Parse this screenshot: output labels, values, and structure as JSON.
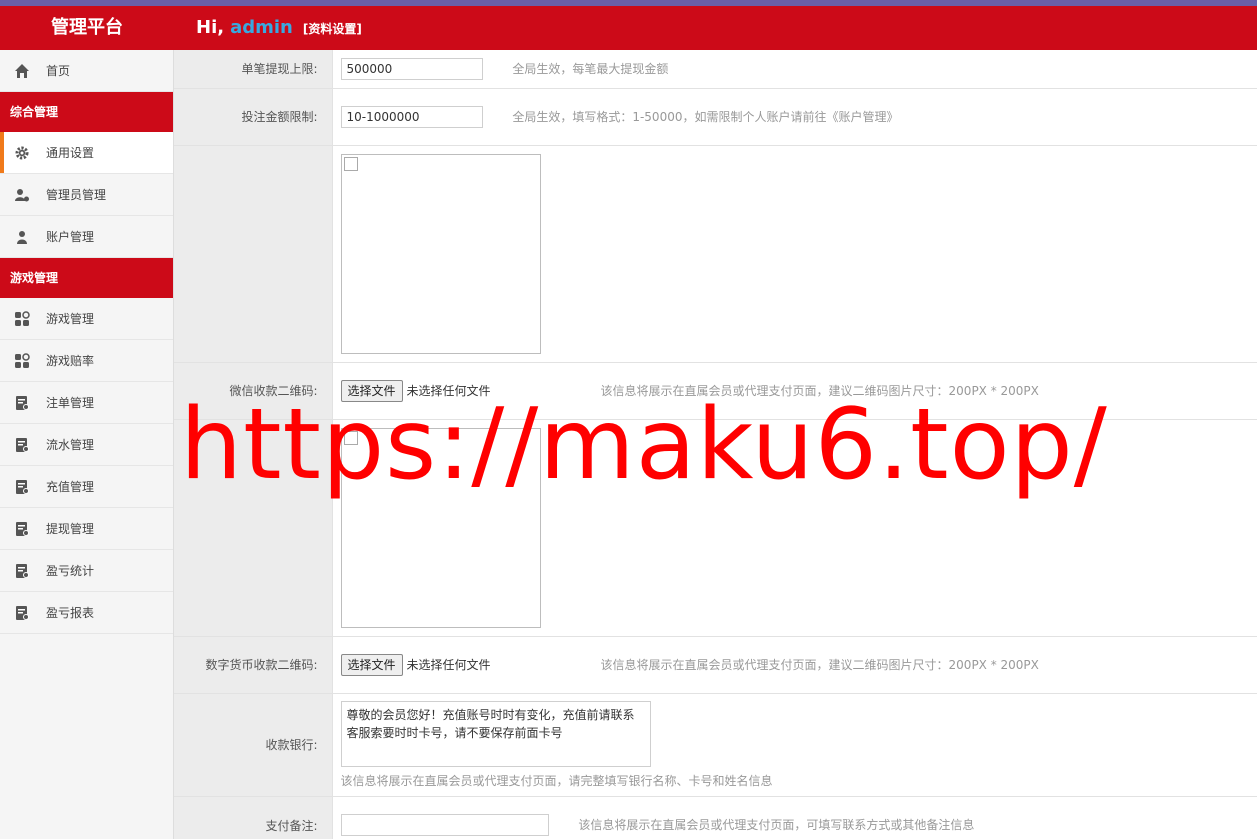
{
  "header": {
    "brand": "管理平台",
    "greeting": "Hi,",
    "username": "admin",
    "profile_link": "[资料设置]"
  },
  "sidebar": {
    "home": "首页",
    "group1": "综合管理",
    "group1_items": [
      "通用设置",
      "管理员管理",
      "账户管理"
    ],
    "group2": "游戏管理",
    "group2_items": [
      "游戏管理",
      "游戏赔率",
      "注单管理",
      "流水管理",
      "充值管理",
      "提现管理",
      "盈亏统计",
      "盈亏报表"
    ]
  },
  "form": {
    "withdraw_limit": {
      "label": "单笔提现上限:",
      "value": "500000",
      "hint": "全局生效，每笔最大提现金额"
    },
    "bet_limit": {
      "label": "投注金额限制:",
      "value": "10-1000000",
      "hint": "全局生效，填写格式：1-50000，如需限制个人账户请前往《账户管理》"
    },
    "wechat_qr": {
      "label": "微信收款二维码:",
      "button": "选择文件",
      "nofile": "未选择任何文件",
      "hint": "该信息将展示在直属会员或代理支付页面，建议二维码图片尺寸：200PX * 200PX"
    },
    "crypto_qr": {
      "label": "数字货币收款二维码:",
      "button": "选择文件",
      "nofile": "未选择任何文件",
      "hint": "该信息将展示在直属会员或代理支付页面，建议二维码图片尺寸：200PX * 200PX"
    },
    "bank": {
      "label": "收款银行:",
      "value": "尊敬的会员您好！充值账号时时有变化，充值前请联系客服索要时时卡号，请不要保存前面卡号",
      "hint": "该信息将展示在直属会员或代理支付页面，请完整填写银行名称、卡号和姓名信息"
    },
    "remark": {
      "label": "支付备注:",
      "value": "",
      "hint": "该信息将展示在直属会员或代理支付页面，可填写联系方式或其他备注信息"
    }
  },
  "watermark": "https://maku6.top/"
}
